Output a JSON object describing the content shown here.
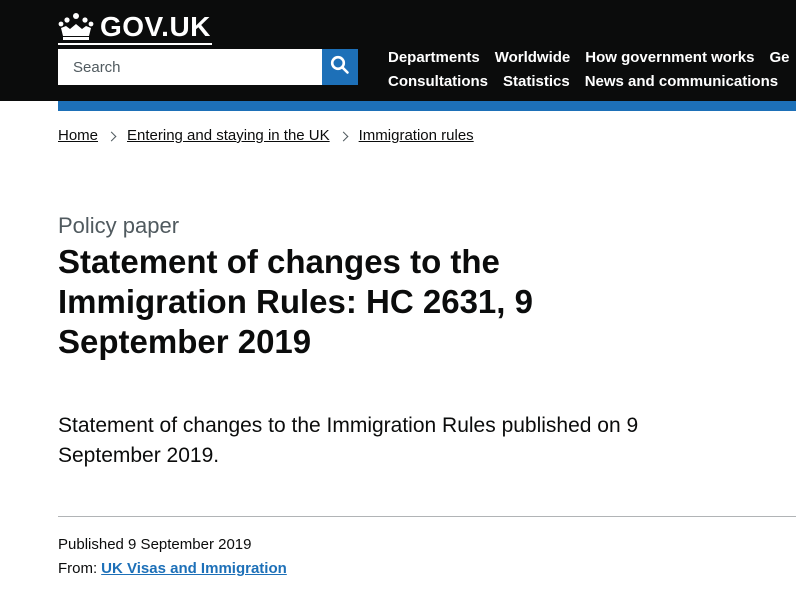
{
  "header": {
    "logo_text": "GOV.UK",
    "search": {
      "placeholder": "Search"
    },
    "nav_row1": [
      "Departments",
      "Worldwide",
      "How government works",
      "Ge"
    ],
    "nav_row2": [
      "Consultations",
      "Statistics",
      "News and communications"
    ]
  },
  "breadcrumbs": [
    "Home",
    "Entering and staying in the UK",
    "Immigration rules"
  ],
  "document": {
    "caption": "Policy paper",
    "title": "Statement of changes to the Immigration Rules: HC 2631, 9 September 2019",
    "lead": "Statement of changes to the Immigration Rules published on 9 September 2019."
  },
  "metadata": {
    "published": "Published 9 September 2019",
    "from_label": "From:",
    "from_org": "UK Visas and Immigration"
  },
  "colors": {
    "header_bg": "#0b0c0c",
    "brand_blue": "#1d70b8",
    "text": "#0b0c0c",
    "secondary_text": "#505a5f"
  },
  "icons": {
    "logo": "crown-icon",
    "search": "search-icon",
    "breadcrumb_separator": "chevron-right-icon"
  }
}
